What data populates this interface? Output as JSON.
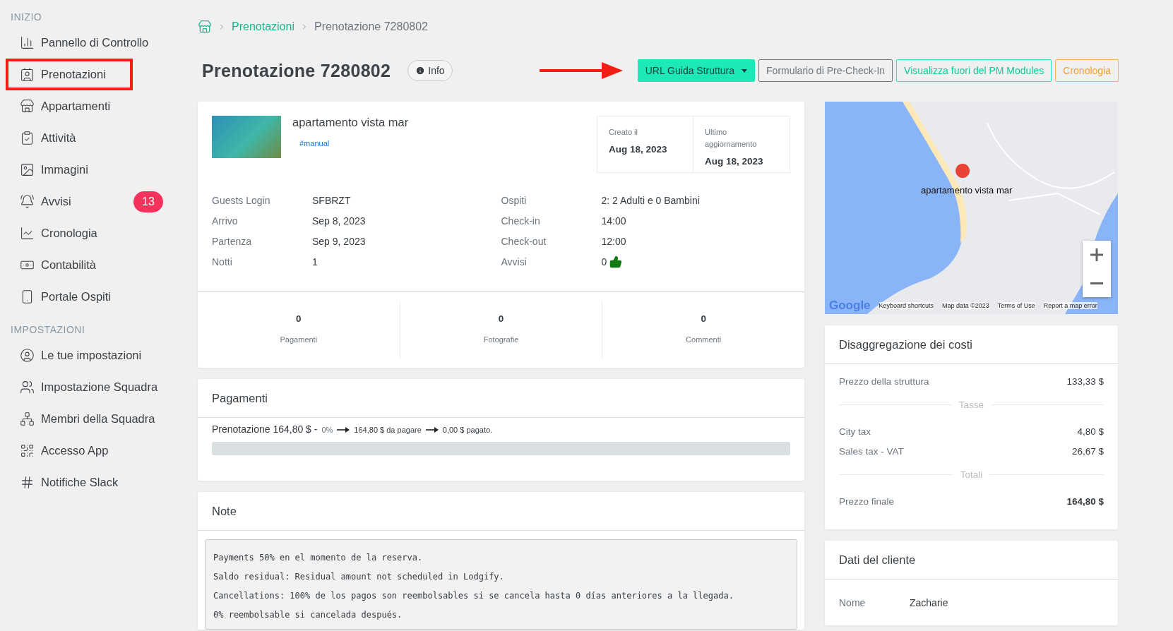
{
  "sidebar": {
    "sections": [
      {
        "title": "INIZIO",
        "items": [
          {
            "label": "Pannello di Controllo",
            "marked": false
          },
          {
            "label": "Prenotazioni",
            "marked": true
          },
          {
            "label": "Appartamenti",
            "marked": false
          },
          {
            "label": "Attività",
            "marked": false
          },
          {
            "label": "Immagini",
            "marked": false
          },
          {
            "label": "Avvisi",
            "marked": false,
            "badge": "13"
          },
          {
            "label": "Cronologia",
            "marked": false
          },
          {
            "label": "Contabilità",
            "marked": false
          },
          {
            "label": "Portale Ospiti",
            "marked": false
          }
        ]
      },
      {
        "title": "IMPOSTAZIONI",
        "items": [
          {
            "label": "Le tue impostazioni",
            "marked": false
          },
          {
            "label": "Impostazione Squadra",
            "marked": false
          },
          {
            "label": "Membri della Squadra",
            "marked": false
          },
          {
            "label": "Accesso App",
            "marked": false
          },
          {
            "label": "Notifiche Slack",
            "marked": false
          }
        ]
      }
    ]
  },
  "breadcrumb": [
    "Prenotazioni",
    "Prenotazione 7280802"
  ],
  "page_title": "Prenotazione 7280802",
  "info_button": "Info",
  "actions": [
    {
      "label": "URL Guida Struttura",
      "kind": "primary",
      "dropdown": true
    },
    {
      "label": "Formulario di Pre-Check-In",
      "kind": "secondary",
      "dropdown": false
    },
    {
      "label": "Visualizza fuori del PM Modules",
      "kind": "success",
      "dropdown": false
    },
    {
      "label": "Cronologia",
      "kind": "warning",
      "dropdown": false
    }
  ],
  "booking": {
    "property": "apartamento vista mar",
    "tag": "#manual",
    "dates": [
      {
        "label": "Creato il",
        "value": "Aug 18, 2023"
      },
      {
        "label": "Ultimo aggiornamento",
        "value": "Aug 18, 2023"
      }
    ],
    "details_left": [
      {
        "label": "Guests Login",
        "value": "SFBRZT"
      },
      {
        "label": "Arrivo",
        "value": "Sep 8, 2023"
      },
      {
        "label": "Partenza",
        "value": "Sep 9, 2023"
      },
      {
        "label": "Notti",
        "value": "1"
      }
    ],
    "details_right": [
      {
        "label": "Ospiti",
        "value": "2: 2 Adulti e 0 Bambini",
        "thumb": false
      },
      {
        "label": "Check-in",
        "value": "14:00",
        "thumb": false
      },
      {
        "label": "Check-out",
        "value": "12:00",
        "thumb": false
      },
      {
        "label": "Avvisi",
        "value": "0",
        "thumb": true
      }
    ],
    "stats": [
      {
        "value": "0",
        "label": "Pagamenti"
      },
      {
        "value": "0",
        "label": "Fotografie"
      },
      {
        "value": "0",
        "label": "Commenti"
      }
    ]
  },
  "payments": {
    "title": "Pagamenti",
    "lead": "Prenotazione 164,80 $ -",
    "percent": "0%",
    "due": "164,80 $ da pagare",
    "paid": "0,00 $ pagato.",
    "level": 0
  },
  "notes": {
    "title": "Note",
    "lines": [
      "Payments 50% en el momento de la reserva.",
      "Saldo residual: Residual amount not scheduled in Lodgify.",
      "Cancellations: 100% de los pagos son reembolsables si se cancela hasta 0 días anteriores a la llegada.",
      "0% reembolsable si cancelada después."
    ]
  },
  "map": {
    "marker_label": "apartamento vista mar",
    "logo": "Google",
    "footer": [
      "Keyboard shortcuts",
      "Map data ©2023",
      "Terms of Use",
      "Report a map error"
    ]
  },
  "costs": {
    "title": "Disaggregazione dei costi",
    "groups": [
      {
        "rows": [
          {
            "label": "Prezzo della struttura",
            "value": "133,33 $",
            "bold": false
          }
        ]
      },
      {
        "divider": "Tasse",
        "rows": [
          {
            "label": "City tax",
            "value": "4,80 $",
            "bold": false
          },
          {
            "label": "Sales tax - VAT",
            "value": "26,67 $",
            "bold": false
          }
        ]
      },
      {
        "divider": "Totali",
        "rows": [
          {
            "label": "Prezzo finale",
            "value": "164,80 $",
            "bold": true
          }
        ]
      }
    ]
  },
  "client": {
    "title": "Dati del cliente",
    "rows": [
      {
        "label": "Nome",
        "value": "Zacharie"
      }
    ]
  }
}
